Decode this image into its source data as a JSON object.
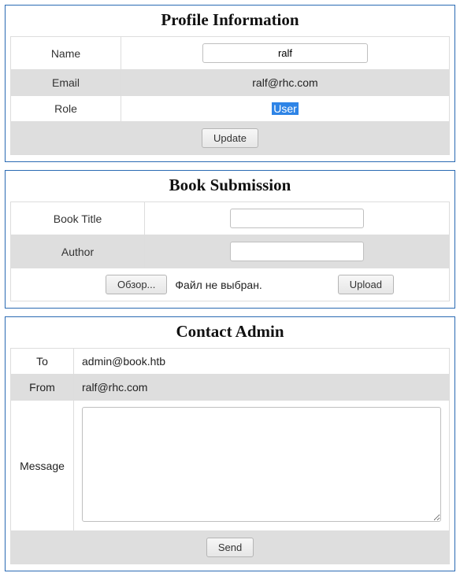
{
  "profile": {
    "title": "Profile Information",
    "name_label": "Name",
    "name_value": "ralf",
    "email_label": "Email",
    "email_value": "ralf@rhc.com",
    "role_label": "Role",
    "role_value": "User",
    "update_label": "Update"
  },
  "book": {
    "title": "Book Submission",
    "title_label": "Book Title",
    "title_value": "",
    "author_label": "Author",
    "author_value": "",
    "browse_label": "Обзор...",
    "file_status": "Файл не выбран.",
    "upload_label": "Upload"
  },
  "contact": {
    "title": "Contact Admin",
    "to_label": "To",
    "to_value": "admin@book.htb",
    "from_label": "From",
    "from_value": "ralf@rhc.com",
    "message_label": "Message",
    "message_value": "",
    "send_label": "Send"
  }
}
